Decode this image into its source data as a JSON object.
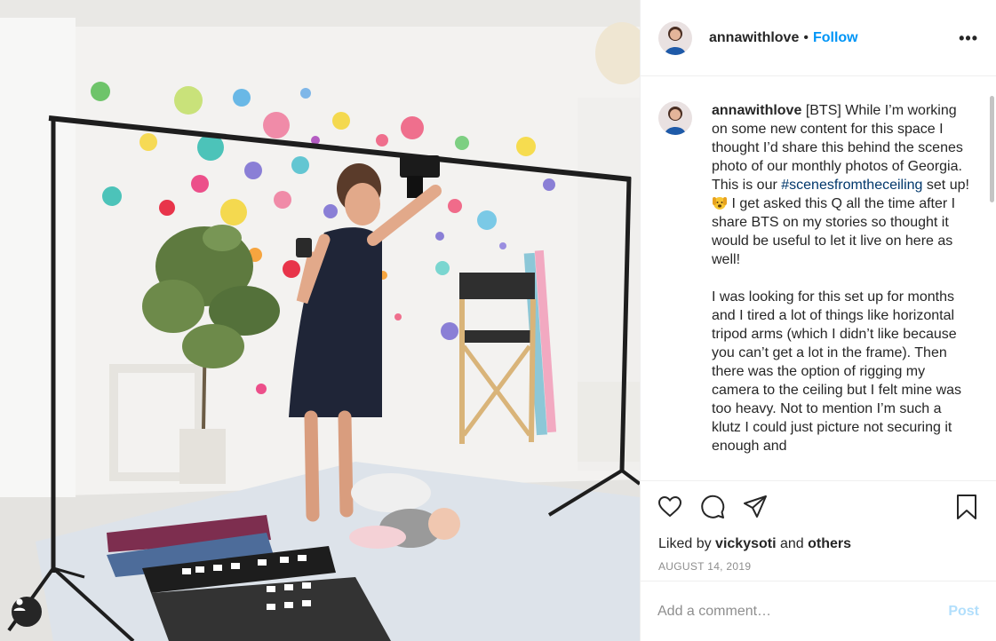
{
  "post": {
    "username": "annawithlove",
    "follow_label": "Follow",
    "separator": "•",
    "more_label": "•••",
    "caption": {
      "username": "annawithlove",
      "part1": "[BTS] While I’m working on some new content for this space I thought I’d share this behind the scenes photo of our monthly photos of Georgia.  This is our ",
      "hashtag": "#scenesfromtheceiling",
      "part2": " set up! ",
      "part3": " I get asked this Q all the time after I share BTS on my stories so thought it would be useful to let it live on here as well!",
      "paragraph2": "I was looking for this set up for months and I tired a lot of things like horizontal tripod arms (which I didn’t like because you can’t get a lot in the frame). Then there was the option of rigging my camera to the ceiling but I felt mine was too heavy.  Not to mention I’m such a klutz I could just picture not securing it enough and"
    },
    "likes": {
      "prefix": "Liked by ",
      "user": "vickysoti",
      "joiner": " and ",
      "others": "others"
    },
    "date": "AUGUST 14, 2019",
    "comment": {
      "placeholder": "Add a comment…",
      "post_label": "Post"
    }
  },
  "icons": {
    "like": "heart-icon",
    "comment": "comment-icon",
    "share": "share-icon",
    "save": "bookmark-icon",
    "user_tags": "user-tag-icon",
    "emoji": "face-hands-emoji"
  },
  "colors": {
    "link_blue": "#0095f6",
    "hashtag": "#00376b",
    "muted": "#8e8e8e",
    "post_disabled": "#b2dffc"
  }
}
